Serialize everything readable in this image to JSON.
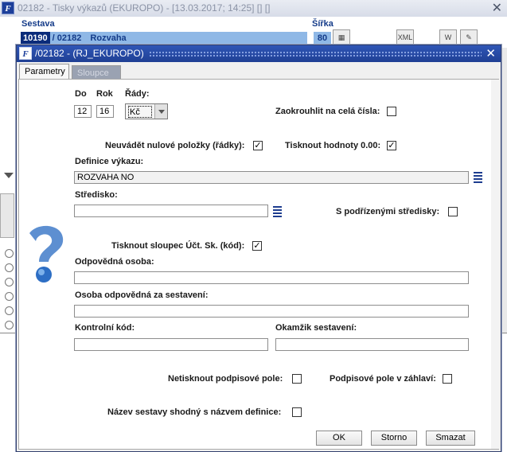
{
  "background": {
    "title": "02182 - Tisky výkazů (EKUROPO) - [13.03.2017; 14:25] [] []",
    "col_sestava": "Sestava",
    "col_sirka": "Šířka",
    "row_code": "10190",
    "row_sep": " / 02182",
    "row_name": "Rozvaha",
    "row_width": "80",
    "btn_xml": "XML",
    "btn_word": "W",
    "btn_close": "✕"
  },
  "dialog": {
    "title": "/02182 - (RJ_EKUROPO)",
    "close": "✕",
    "tabs": [
      "Parametry",
      "Sloupce"
    ]
  },
  "form": {
    "do_label": "Do",
    "do_value": "12",
    "rok_label": "Rok",
    "rok_value": "16",
    "rady_label": "Řády:",
    "rady_value": "Kč",
    "zaokrouhlit_label": "Zaokrouhlit na celá čísla:",
    "zaokrouhlit_checked": false,
    "neuvadet_label": "Neuvádět nulové položky (řádky):",
    "neuvadet_checked": true,
    "tisknout_hodnoty_label": "Tisknout hodnoty 0.00:",
    "tisknout_hodnoty_checked": true,
    "definice_label": "Definice výkazu:",
    "definice_value": "ROZVAHA NO",
    "stredisko_label": "Středisko:",
    "stredisko_value": "",
    "podrizene_label": "S podřízenými středisky:",
    "podrizene_checked": false,
    "tisknout_sloupec_label": "Tisknout sloupec Účt. Sk. (kód):",
    "tisknout_sloupec_checked": true,
    "odpovedna_label": "Odpovědná osoba:",
    "odpovedna_value": "",
    "osoba_sestaveni_label": "Osoba odpovědná za sestavení:",
    "osoba_sestaveni_value": "",
    "kontrolni_label": "Kontrolní kód:",
    "kontrolni_value": "",
    "okamzik_label": "Okamžik sestavení:",
    "okamzik_value": "",
    "netisknout_podpis_label": "Netisknout podpisové pole:",
    "netisknout_podpis_checked": false,
    "podpis_zahlavi_label": "Podpisové pole v záhlaví:",
    "podpis_zahlavi_checked": false,
    "nazev_shodny_label": "Název sestavy shodný s názvem definice:",
    "nazev_shodny_checked": false
  },
  "buttons": {
    "ok": "OK",
    "storno": "Storno",
    "smazat": "Smazat"
  },
  "colors": {
    "dialog_title_bg": "#2f56b6",
    "selection_bg": "#8fb8e6",
    "label_blue": "#143b89"
  }
}
